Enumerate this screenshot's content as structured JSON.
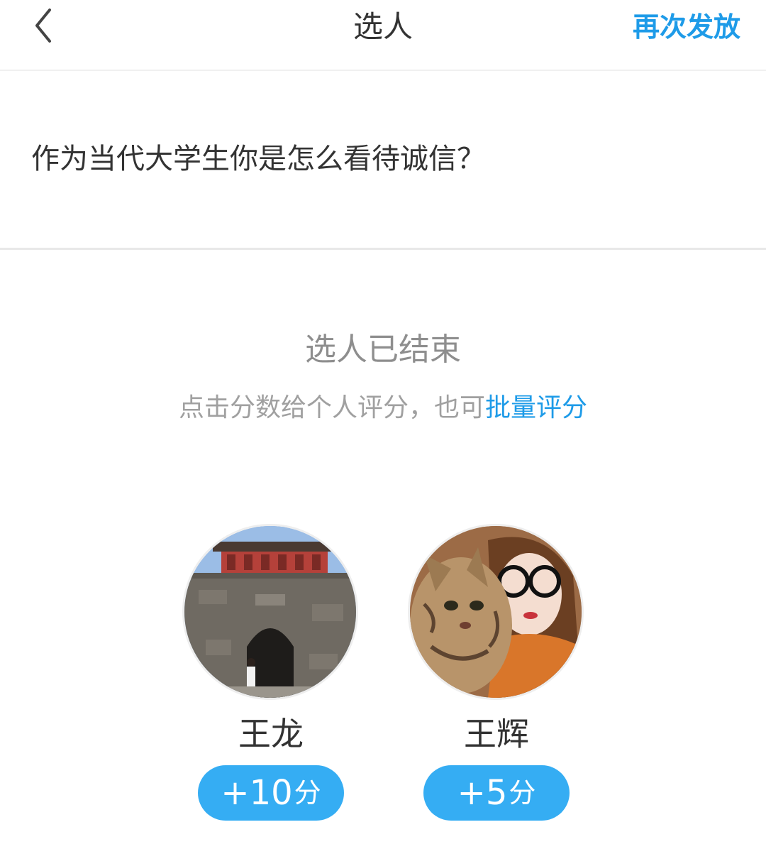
{
  "header": {
    "title": "选人",
    "action_label": "再次发放",
    "back_icon": "chevron-left-icon"
  },
  "question": {
    "text": "作为当代大学生你是怎么看待诚信？"
  },
  "status": {
    "title": "选人已结束",
    "hint_prefix": "点击分数给个人评分，也可",
    "hint_link": "批量评分"
  },
  "colors": {
    "accent": "#1e9be8",
    "score_button": "#35adf3"
  },
  "members": [
    {
      "name": "王龙",
      "score": "+10",
      "unit": "分"
    },
    {
      "name": "王辉",
      "score": "+5",
      "unit": "分"
    }
  ]
}
